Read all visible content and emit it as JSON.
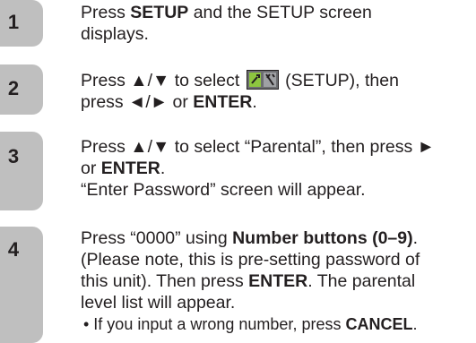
{
  "steps": [
    {
      "number": "1",
      "lines": {
        "l1_pre": "Press ",
        "l1_bold": "SETUP",
        "l1_post": " and the SETUP screen",
        "l2": "displays."
      }
    },
    {
      "number": "2",
      "lines": {
        "l1_pre": "Press ▲/▼ to select ",
        "l1_post": " (SETUP), then",
        "l2_pre": "press ◄/► or ",
        "l2_bold": "ENTER",
        "l2_post": "."
      }
    },
    {
      "number": "3",
      "lines": {
        "l1": "Press ▲/▼ to select “Parental”, then press ►",
        "l2_pre": "or ",
        "l2_bold": "ENTER",
        "l2_post": ".",
        "l3": "“Enter Password” screen will appear."
      }
    },
    {
      "number": "4",
      "lines": {
        "l1_pre": "Press “0000” using ",
        "l1_bold": "Number buttons (0–9)",
        "l1_post": ".",
        "l2": "(Please note, this is pre-setting password of",
        "l3_pre": "this unit). Then press ",
        "l3_bold": "ENTER",
        "l3_post": ". The parental",
        "l4": "level list will appear.",
        "bullet_pre": "• If you input a wrong number, press ",
        "bullet_bold": "CANCEL",
        "bullet_post": "."
      }
    }
  ],
  "icons": {
    "setup_icon": "setup-wrench-screwdriver-icon"
  },
  "colors": {
    "tab_background": "#bfbfbf",
    "text": "#231f20"
  }
}
